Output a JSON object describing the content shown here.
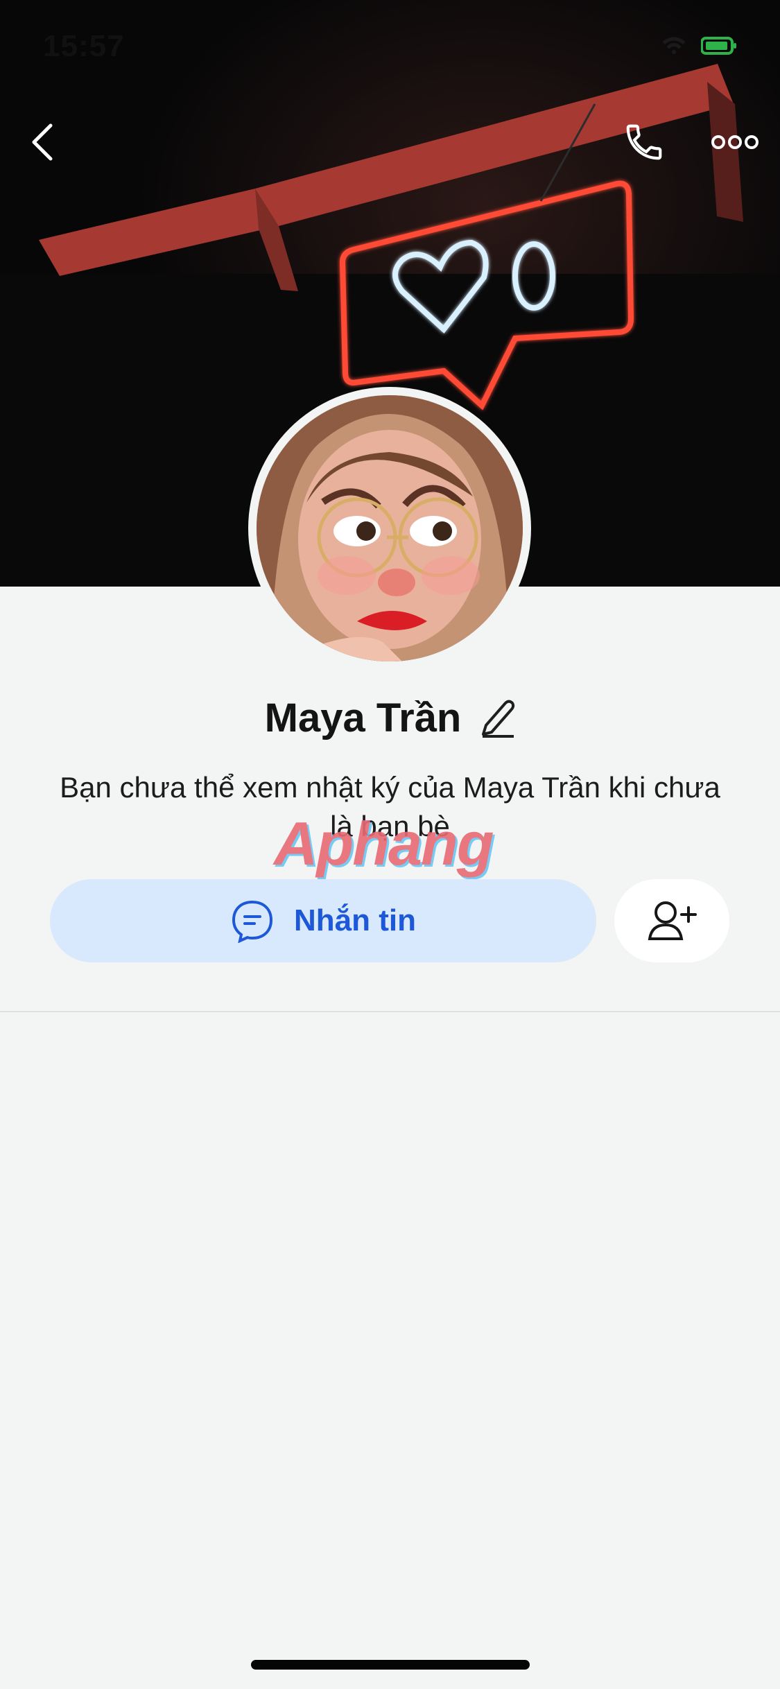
{
  "status": {
    "time": "15:57"
  },
  "profile": {
    "name": "Maya Trần",
    "notice": "Bạn chưa thể xem nhật ký của Maya Trần khi chưa là bạn bè"
  },
  "actions": {
    "message_label": "Nhắn tin"
  },
  "watermark": "Aphang",
  "colors": {
    "accent": "#1d58d8",
    "message_bg": "#d8e8fd",
    "page_bg": "#f3f4f4",
    "neon_red": "#ff4b36"
  },
  "icons": {
    "back": "chevron-left-icon",
    "call": "phone-icon",
    "more": "more-horizontal-icon",
    "edit": "pencil-icon",
    "message": "chat-bubble-icon",
    "add_friend": "add-user-icon"
  }
}
